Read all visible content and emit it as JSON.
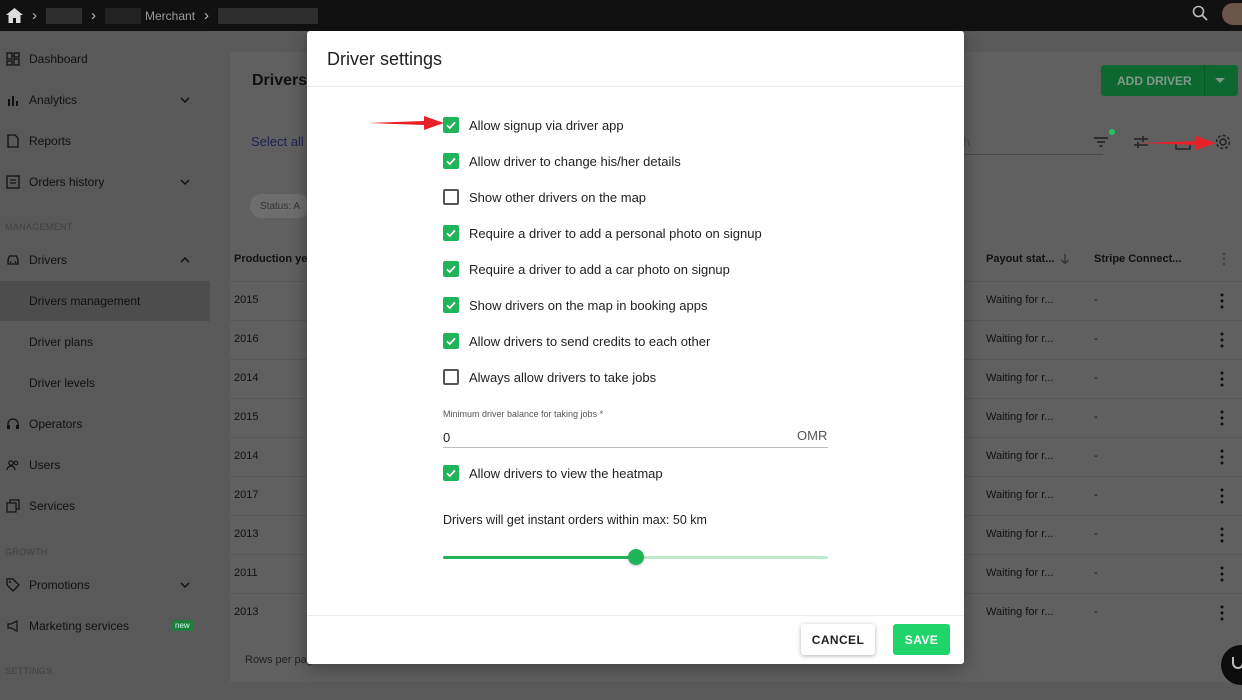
{
  "topbar": {
    "crumb": "Merchant"
  },
  "sidebar": {
    "items": [
      {
        "label": "Dashboard"
      },
      {
        "label": "Analytics"
      },
      {
        "label": "Reports"
      },
      {
        "label": "Orders history"
      },
      {
        "label": "Drivers"
      },
      {
        "label": "Drivers management"
      },
      {
        "label": "Driver plans"
      },
      {
        "label": "Driver levels"
      },
      {
        "label": "Operators"
      },
      {
        "label": "Users"
      },
      {
        "label": "Services"
      },
      {
        "label": "Promotions"
      },
      {
        "label": "Marketing services",
        "badge": "new"
      }
    ],
    "sections": [
      "MANAGEMENT",
      "GROWTH",
      "SETTINGS"
    ]
  },
  "content": {
    "title": "Drivers",
    "add_driver_label": "ADD DRIVER",
    "select_all": "Select all",
    "search_fragment": "h",
    "status_chip": "Status: A",
    "columns": [
      "Production ye",
      "Payout stat...",
      "Stripe Connect..."
    ],
    "rows": [
      {
        "year": "2015",
        "payout": "Waiting for r...",
        "stripe": "-"
      },
      {
        "year": "2016",
        "payout": "Waiting for r...",
        "stripe": "-"
      },
      {
        "year": "2014",
        "payout": "Waiting for r...",
        "stripe": "-"
      },
      {
        "year": "2015",
        "payout": "Waiting for r...",
        "stripe": "-"
      },
      {
        "year": "2014",
        "payout": "Waiting for r...",
        "stripe": "-"
      },
      {
        "year": "2017",
        "payout": "Waiting for r...",
        "stripe": "-"
      },
      {
        "year": "2013",
        "payout": "Waiting for r...",
        "stripe": "-"
      },
      {
        "year": "2011",
        "payout": "Waiting for r...",
        "stripe": "-"
      },
      {
        "year": "2013",
        "payout": "Waiting for r...",
        "stripe": "-"
      }
    ],
    "rows_per_page": "Rows per pag"
  },
  "modal": {
    "title": "Driver settings",
    "options": [
      {
        "label": "Allow signup via driver app",
        "checked": true
      },
      {
        "label": "Allow driver to change his/her details",
        "checked": true
      },
      {
        "label": "Show other drivers on the map",
        "checked": false
      },
      {
        "label": "Require a driver to add a personal photo on signup",
        "checked": true
      },
      {
        "label": "Require a driver to add a car photo on signup",
        "checked": true
      },
      {
        "label": "Show drivers on the map in booking apps",
        "checked": true
      },
      {
        "label": "Allow drivers to send credits to each other",
        "checked": true
      },
      {
        "label": "Always allow drivers to take jobs",
        "checked": false
      }
    ],
    "min_balance": {
      "label": "Minimum driver balance for taking jobs *",
      "value": "0",
      "suffix": "OMR"
    },
    "heatmap_option": {
      "label": "Allow drivers to view the heatmap",
      "checked": true
    },
    "instant_orders_text": "Drivers will get instant orders within max: 50 km",
    "slider_fraction": 0.5,
    "cancel_label": "CANCEL",
    "save_label": "SAVE"
  },
  "colors": {
    "accent": "#1fb45a",
    "save": "#1fd46a",
    "arrow": "#e8202a"
  }
}
